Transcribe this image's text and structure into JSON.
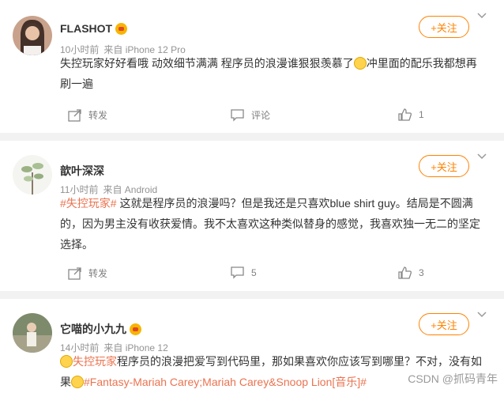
{
  "posts": [
    {
      "username": "FLASHOT",
      "meta": [
        "10小时前",
        "来自 iPhone 12 Pro"
      ],
      "follow_label": "+关注",
      "text_parts": [
        "失控玩家好好看哦 动效细节满满 程序员的浪漫谁狠狠羡慕了",
        "冲里面的配乐我都想再刷一遍"
      ],
      "repost_label": "转发",
      "comment_label": "评论",
      "like_count": "1"
    },
    {
      "username": "歆叶深深",
      "meta": [
        "11小时前",
        "来自 Android"
      ],
      "follow_label": "+关注",
      "tag": "#失控玩家#",
      "text": " 这就是程序员的浪漫吗？但是我还是只喜欢blue shirt guy。结局是不圆满的，因为男主没有收获爱情。我不太喜欢这种类似替身的感觉，我喜欢独一无二的坚定选择。",
      "repost_label": "转发",
      "comment_count": "5",
      "like_count": "3"
    },
    {
      "username": "它喵的小九九",
      "meta": [
        "14小时前",
        "来自 iPhone 12"
      ],
      "follow_label": "+关注",
      "tag": "失控玩家",
      "text_a": "程序员的浪漫把爱写到代码里，那如果喜欢你应该写到哪里？不对，没有如果",
      "tag2": "#Fantasy-Mariah Carey;Mariah Carey&Snoop Lion[音乐]#"
    }
  ],
  "watermark": "CSDN @抓码青年",
  "colors": {
    "accent": "#ff8200",
    "tag": "#eb7350",
    "meta": "#939393"
  }
}
